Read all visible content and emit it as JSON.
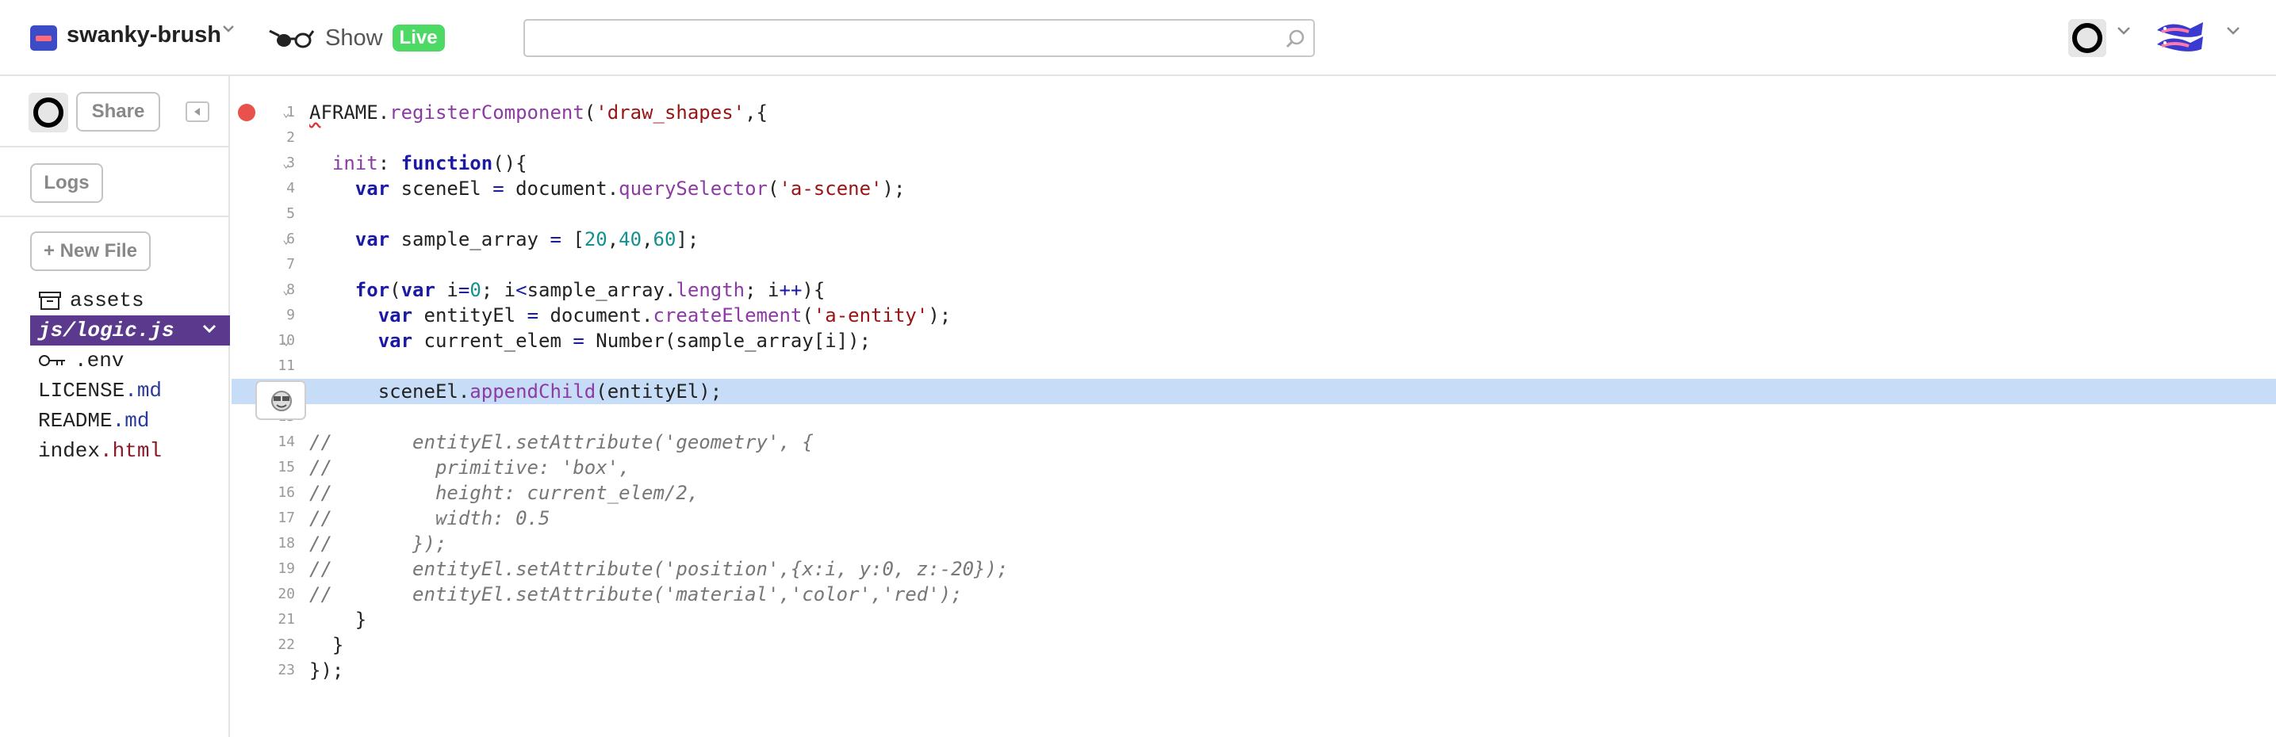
{
  "header": {
    "project_name": "swanky-brush",
    "show_label": "Show",
    "live_badge": "Live",
    "search_placeholder": ""
  },
  "sidebar": {
    "share_label": "Share",
    "logs_label": "Logs",
    "new_file_label": "+ New File",
    "files": [
      {
        "name": "assets",
        "ext": "",
        "icon": "archive-icon",
        "active": false
      },
      {
        "name": "js/logic.js",
        "ext": "",
        "icon": "",
        "active": true
      },
      {
        "name": ".env",
        "ext": "",
        "icon": "key-icon",
        "active": false
      },
      {
        "name": "LICENSE",
        "ext": ".md",
        "icon": "",
        "active": false
      },
      {
        "name": "README",
        "ext": ".md",
        "icon": "",
        "active": false
      },
      {
        "name": "index",
        "ext": ".html",
        "icon": "",
        "active": false
      }
    ]
  },
  "editor": {
    "highlighted_line": 12,
    "breakpoint_line": 1,
    "lines": [
      {
        "n": "1",
        "fold": true,
        "tokens": [
          [
            "wavy",
            "A"
          ],
          [
            "",
            "FRAME."
          ],
          [
            "fn",
            "registerComponent"
          ],
          [
            "",
            "("
          ],
          [
            "str",
            "'draw_shapes'"
          ],
          [
            "",
            ",{"
          ]
        ]
      },
      {
        "n": "2",
        "fold": false,
        "tokens": []
      },
      {
        "n": "3",
        "fold": true,
        "tokens": [
          [
            "",
            "  "
          ],
          [
            "fn",
            "init"
          ],
          [
            "",
            ": "
          ],
          [
            "kw",
            "function"
          ],
          [
            "",
            "(){"
          ]
        ]
      },
      {
        "n": "4",
        "fold": false,
        "tokens": [
          [
            "",
            "    "
          ],
          [
            "kw",
            "var"
          ],
          [
            "",
            " sceneEl "
          ],
          [
            "op",
            "="
          ],
          [
            "",
            " document."
          ],
          [
            "fn",
            "querySelector"
          ],
          [
            "",
            "("
          ],
          [
            "str",
            "'a-scene'"
          ],
          [
            "",
            ");"
          ]
        ]
      },
      {
        "n": "5",
        "fold": false,
        "tokens": []
      },
      {
        "n": "6",
        "fold": true,
        "tokens": [
          [
            "",
            "    "
          ],
          [
            "kw",
            "var"
          ],
          [
            "",
            " sample_array "
          ],
          [
            "op",
            "="
          ],
          [
            "",
            " ["
          ],
          [
            "num",
            "20"
          ],
          [
            "",
            ","
          ],
          [
            "num",
            "40"
          ],
          [
            "",
            ","
          ],
          [
            "num",
            "60"
          ],
          [
            "",
            "];"
          ]
        ]
      },
      {
        "n": "7",
        "fold": false,
        "tokens": []
      },
      {
        "n": "8",
        "fold": true,
        "tokens": [
          [
            "",
            "    "
          ],
          [
            "kw",
            "for"
          ],
          [
            "",
            "("
          ],
          [
            "kw",
            "var"
          ],
          [
            "",
            " i"
          ],
          [
            "op",
            "="
          ],
          [
            "num",
            "0"
          ],
          [
            "",
            "; i"
          ],
          [
            "op",
            "<"
          ],
          [
            "",
            "sample_array."
          ],
          [
            "fn",
            "length"
          ],
          [
            "",
            "; i"
          ],
          [
            "op",
            "++"
          ],
          [
            "",
            "){"
          ]
        ]
      },
      {
        "n": "9",
        "fold": false,
        "tokens": [
          [
            "",
            "      "
          ],
          [
            "kw",
            "var"
          ],
          [
            "",
            " entityEl "
          ],
          [
            "op",
            "="
          ],
          [
            "",
            " document."
          ],
          [
            "fn",
            "createElement"
          ],
          [
            "",
            "("
          ],
          [
            "str",
            "'a-entity'"
          ],
          [
            "",
            ");"
          ]
        ]
      },
      {
        "n": "10",
        "fold": true,
        "tokens": [
          [
            "",
            "      "
          ],
          [
            "kw",
            "var"
          ],
          [
            "",
            " current_elem "
          ],
          [
            "op",
            "="
          ],
          [
            "",
            " Number(sample_array[i]);"
          ]
        ]
      },
      {
        "n": "11",
        "fold": false,
        "tokens": []
      },
      {
        "n": "",
        "fold": false,
        "tokens": [
          [
            "",
            "      sceneEl."
          ],
          [
            "fn",
            "appendChild"
          ],
          [
            "",
            "(entityEl);"
          ]
        ]
      },
      {
        "n": "13",
        "fold": false,
        "tokens": []
      },
      {
        "n": "14",
        "fold": false,
        "tokens": [
          [
            "cm",
            "//       entityEl.setAttribute('geometry', {"
          ]
        ]
      },
      {
        "n": "15",
        "fold": false,
        "tokens": [
          [
            "cm",
            "//         primitive: 'box',"
          ]
        ]
      },
      {
        "n": "16",
        "fold": false,
        "tokens": [
          [
            "cm",
            "//         height: current_elem/2,"
          ]
        ]
      },
      {
        "n": "17",
        "fold": false,
        "tokens": [
          [
            "cm",
            "//         width: 0.5"
          ]
        ]
      },
      {
        "n": "18",
        "fold": false,
        "tokens": [
          [
            "cm",
            "//       });"
          ]
        ]
      },
      {
        "n": "19",
        "fold": false,
        "tokens": [
          [
            "cm",
            "//       entityEl.setAttribute('position',{x:i, y:0, z:-20});"
          ]
        ]
      },
      {
        "n": "20",
        "fold": false,
        "tokens": [
          [
            "cm",
            "//       entityEl.setAttribute('material','color','red');"
          ]
        ]
      },
      {
        "n": "21",
        "fold": false,
        "tokens": [
          [
            "",
            "    }"
          ]
        ]
      },
      {
        "n": "22",
        "fold": false,
        "tokens": [
          [
            "",
            "  }"
          ]
        ]
      },
      {
        "n": "23",
        "fold": false,
        "tokens": [
          [
            "",
            "});"
          ]
        ]
      }
    ]
  },
  "colors": {
    "active_file_bg": "#5b3a8e",
    "live_badge": "#4cd964",
    "highlight_line": "#c7ddf7",
    "breakpoint": "#e8524a"
  }
}
